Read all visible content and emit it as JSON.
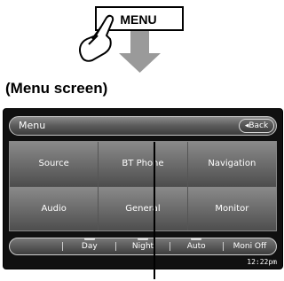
{
  "illustration": {
    "key_label": "MENU"
  },
  "caption": "(Menu screen)",
  "screen": {
    "title": "Menu",
    "back_label": "◂Back",
    "grid": [
      {
        "label": "Source"
      },
      {
        "label": "BT Phone"
      },
      {
        "label": "Navigation"
      },
      {
        "label": "Audio"
      },
      {
        "label": "General"
      },
      {
        "label": "Monitor"
      }
    ],
    "bottom": [
      {
        "label": "",
        "indicator": false
      },
      {
        "label": "Day",
        "indicator": true
      },
      {
        "label": "Night",
        "indicator": true
      },
      {
        "label": "Auto",
        "indicator": true
      },
      {
        "label": "Moni Off",
        "indicator": false
      }
    ],
    "clock": "12:22pm"
  },
  "colors": {
    "screen_bg": "#101010",
    "button_top": "#8a8a8a",
    "button_bottom": "#4e4e4e",
    "text": "#ffffff"
  }
}
